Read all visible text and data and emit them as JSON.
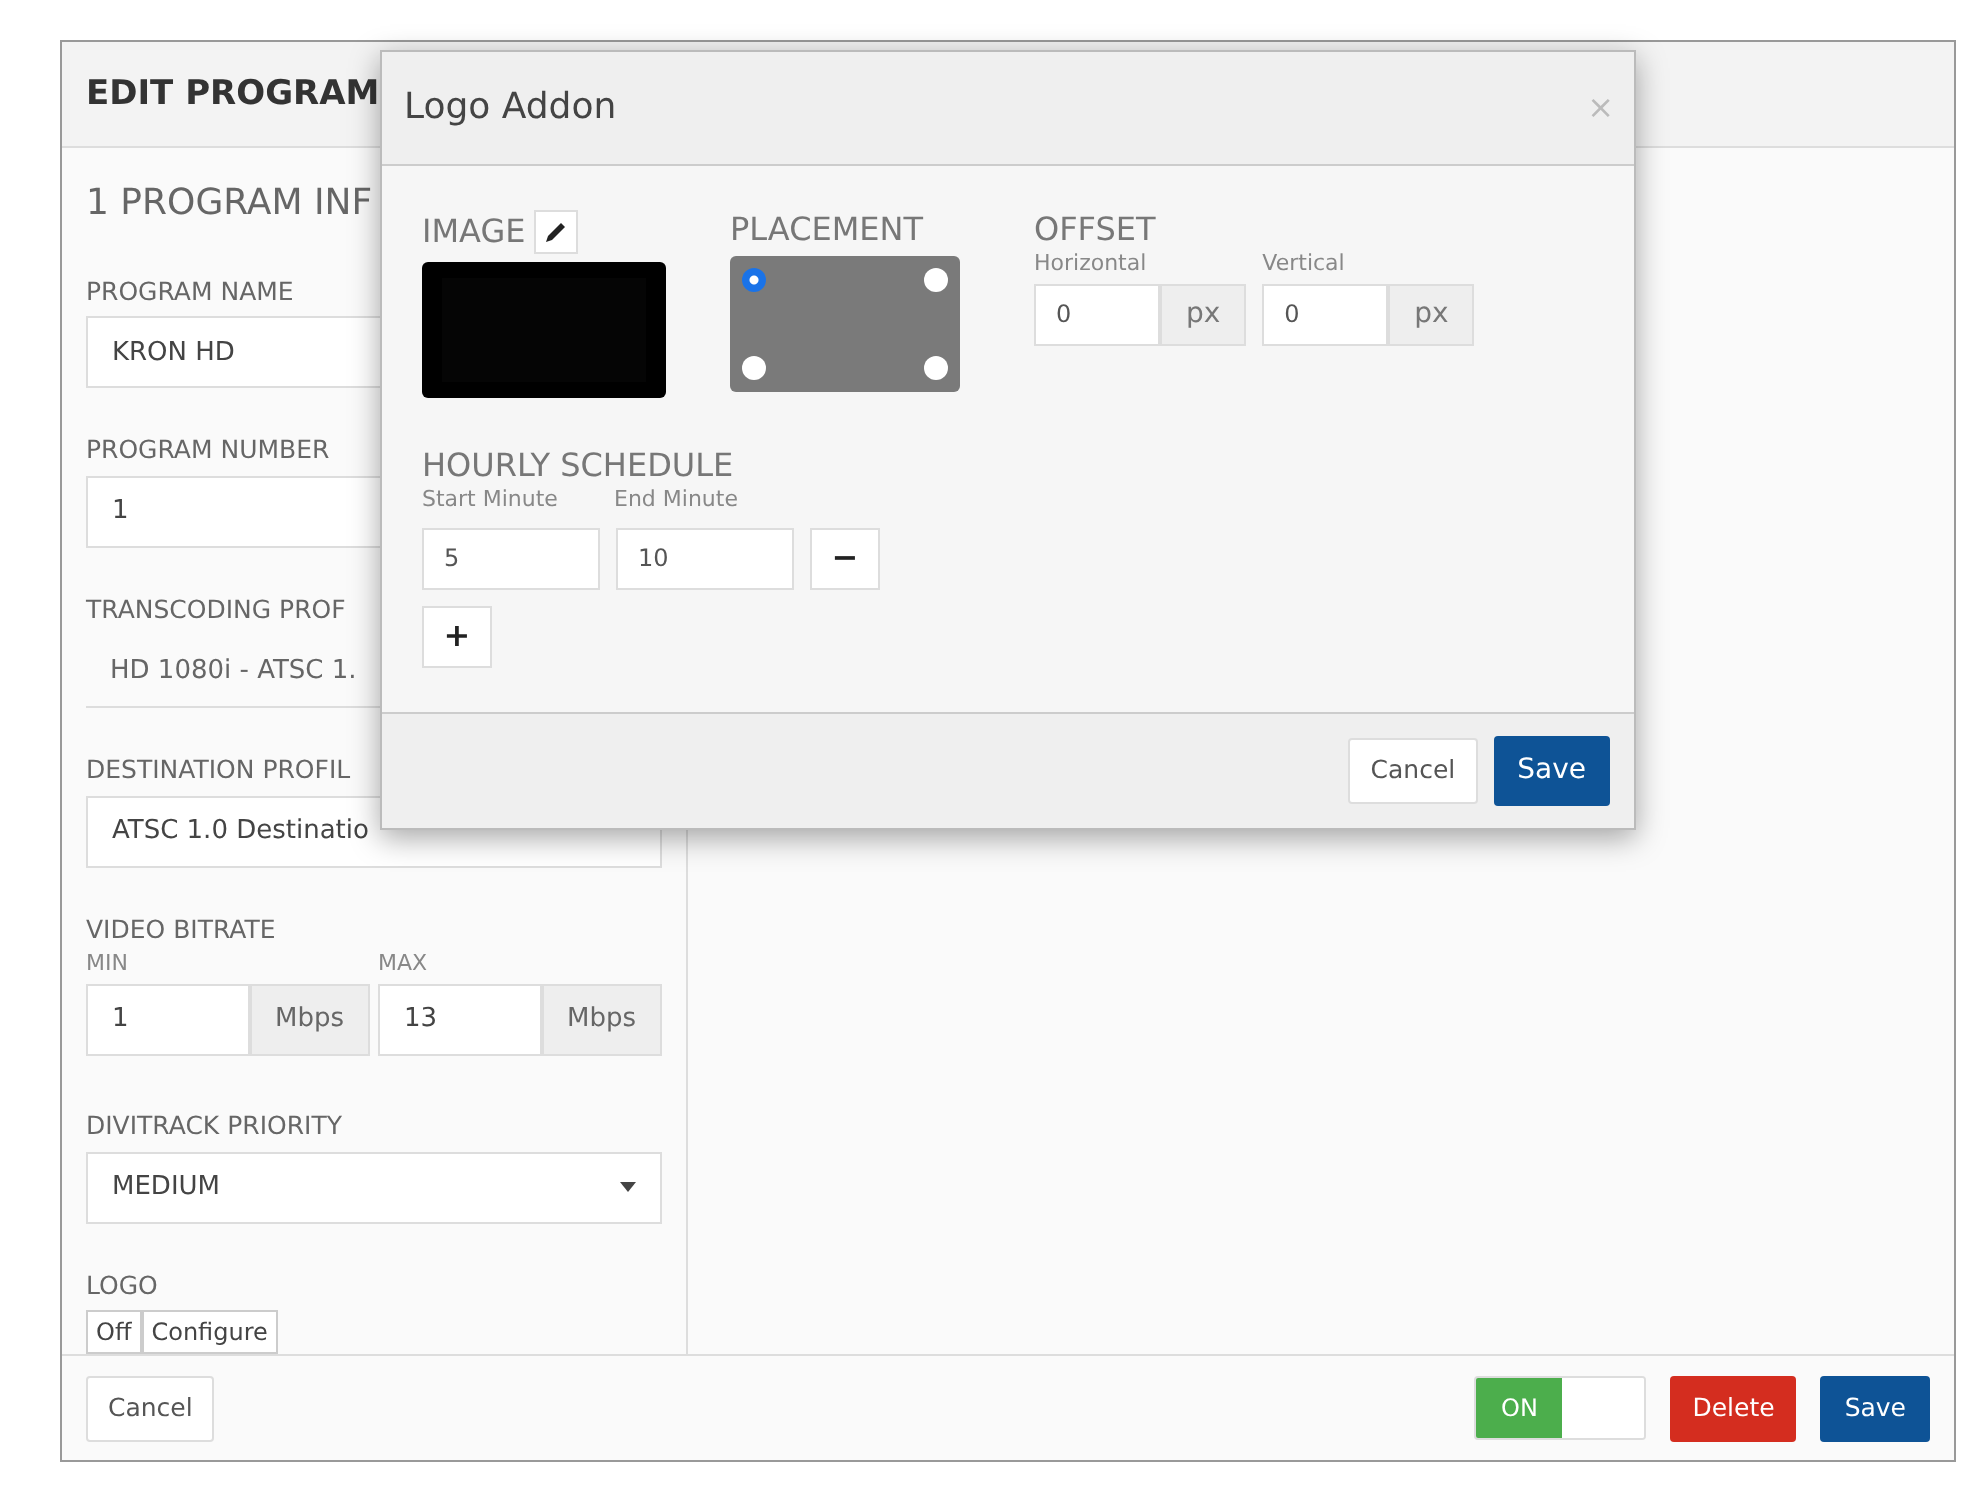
{
  "editor": {
    "title": "EDIT PROGRAM",
    "section": "1 PROGRAM INF"
  },
  "fields": [
    {
      "kind": "input",
      "label": "PROGRAM NAME",
      "value": "KRON HD"
    },
    {
      "kind": "input",
      "label": "PROGRAM NUMBER",
      "value": "1"
    },
    {
      "kind": "plain",
      "label": "TRANSCODING PROF",
      "value": "HD 1080i - ATSC 1."
    },
    {
      "kind": "input",
      "label": "DESTINATION PROFIL",
      "value": "ATSC 1.0 Destinatio"
    }
  ],
  "video_bitrate": {
    "label": "VIDEO BITRATE",
    "min": {
      "label": "MIN",
      "value": "1",
      "unit": "Mbps"
    },
    "max": {
      "label": "MAX",
      "value": "13",
      "unit": "Mbps"
    }
  },
  "divitrack_priority": {
    "label": "DIVITRACK PRIORITY",
    "value": "MEDIUM"
  },
  "logo": {
    "label": "LOGO",
    "buttons": [
      "Off",
      "Configure"
    ]
  },
  "footer": {
    "cancel": "Cancel",
    "toggle": {
      "label": "ON",
      "on": true
    },
    "delete": "Delete",
    "save": "Save"
  },
  "modal": {
    "title": "Logo Addon",
    "close": "×",
    "image_label": "IMAGE",
    "placement": {
      "label": "PLACEMENT",
      "corners": [
        {
          "selected": true
        },
        {
          "selected": false
        },
        {
          "selected": false
        },
        {
          "selected": false
        }
      ]
    },
    "offset": {
      "label": "OFFSET",
      "fields": [
        {
          "label": "Horizontal",
          "value": "0",
          "unit": "px"
        },
        {
          "label": "Vertical",
          "value": "0",
          "unit": "px"
        }
      ]
    },
    "schedule": {
      "label": "HOURLY SCHEDULE",
      "start_label": "Start Minute",
      "end_label": "End Minute",
      "rows": [
        {
          "start": "5",
          "end": "10",
          "remove": "−"
        }
      ],
      "add": "+"
    },
    "cancel": "Cancel",
    "save": "Save"
  }
}
